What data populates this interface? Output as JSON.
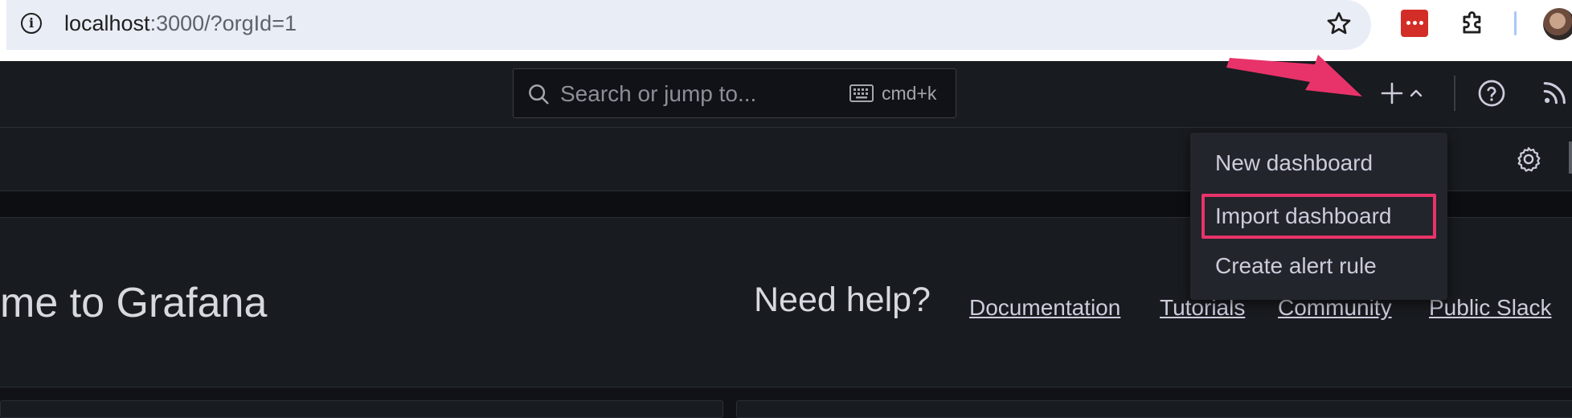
{
  "browser": {
    "url_host": "localhost",
    "url_rest": ":3000/?orgId=1",
    "icons": [
      "info-icon",
      "star-icon",
      "password-extension-icon",
      "puzzle-icon",
      "avatar"
    ]
  },
  "topbar": {
    "search_placeholder": "Search or jump to...",
    "shortcut": "cmd+k",
    "icons": [
      "search-icon",
      "keyboard-icon",
      "plus-icon",
      "chevron-up-icon",
      "help-icon",
      "rss-icon"
    ]
  },
  "menu": {
    "items": [
      {
        "label": "New dashboard"
      },
      {
        "label": "Import dashboard",
        "highlighted": true
      },
      {
        "label": "Create alert rule"
      }
    ]
  },
  "main": {
    "welcome": "me to Grafana",
    "need_help": "Need help?",
    "links": [
      "Documentation",
      "Tutorials",
      "Community",
      "Public Slack"
    ]
  },
  "colors": {
    "annotation": "#e8336a",
    "background": "#111217",
    "panel": "#181b1f"
  }
}
